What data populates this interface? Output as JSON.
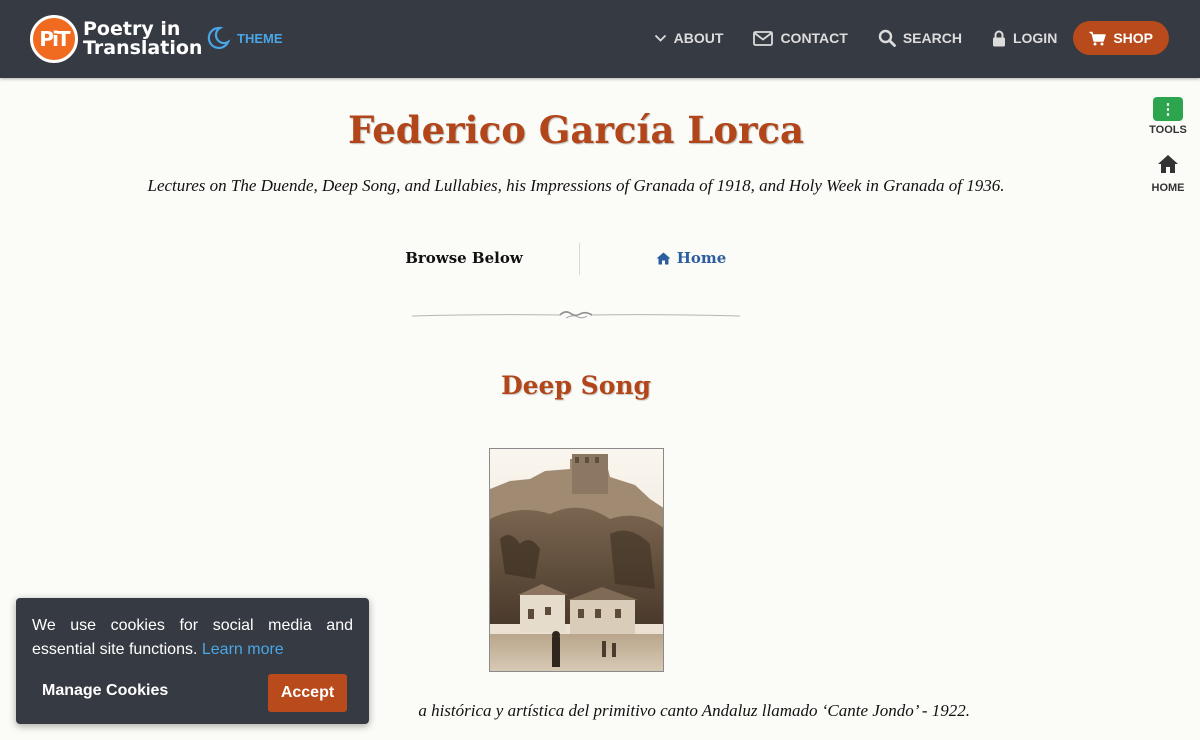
{
  "header": {
    "logo_mark": "PiT",
    "logo_line1": "Poetry in",
    "logo_line2": "Translation",
    "theme_label": "THEME",
    "nav": {
      "about": "ABOUT",
      "contact": "CONTACT",
      "search": "SEARCH",
      "login": "LOGIN",
      "shop": "SHOP"
    }
  },
  "side_tools": {
    "tools_label": "TOOLS",
    "home_label": "HOME"
  },
  "page": {
    "title": "Federico García Lorca",
    "subtitle": "Lectures on The Duende, Deep Song, and Lullabies, his Impressions of Granada of 1918, and Holy Week in Granada of 1936.",
    "browse_label": "Browse Below",
    "home_link": "Home",
    "section_title": "Deep Song",
    "caption": "a histórica y artística del primitivo canto Andaluz llamado ‘Cante Jondo’ - 1922."
  },
  "cookie_banner": {
    "text": "We use cookies for social media and essential site functions.",
    "learn_more": "Learn more",
    "manage_label": "Manage Cookies",
    "accept_label": "Accept"
  },
  "colors": {
    "header_bg": "#363a42",
    "accent": "#b2461a",
    "link_blue": "#2c5d9e",
    "theme_blue": "#4aa6e6",
    "tools_green": "#2da44e"
  }
}
